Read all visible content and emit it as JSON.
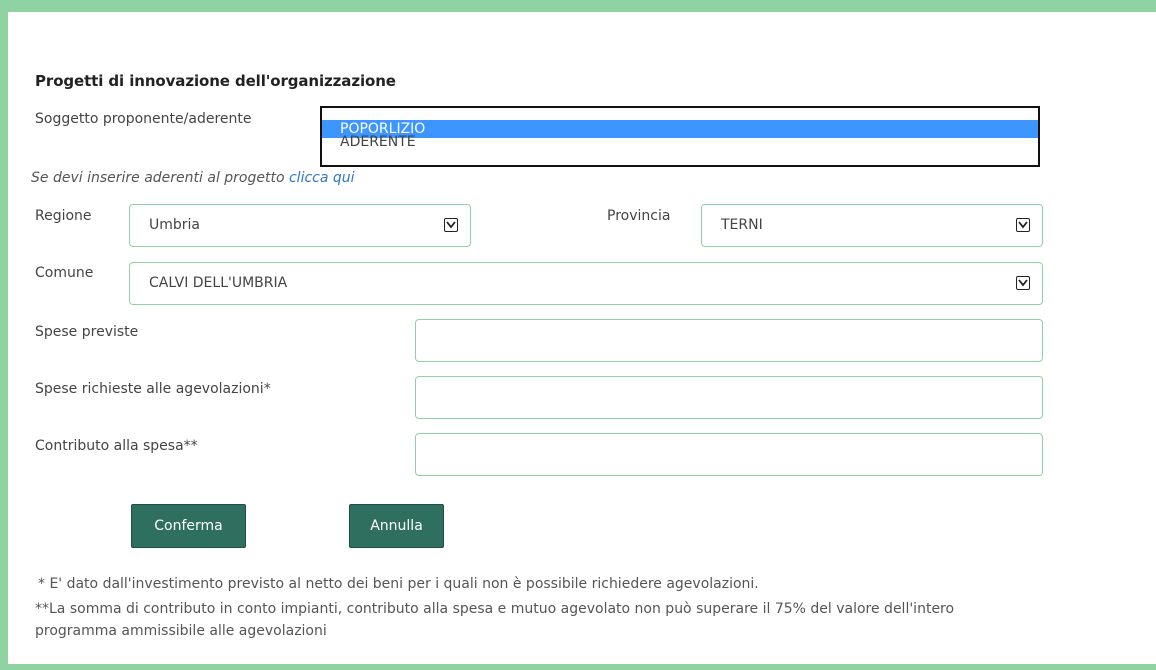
{
  "form": {
    "title": "Progetti di innovazione dell'organizzazione",
    "soggetto_label": "Soggetto proponente/aderente",
    "soggetto_options": [
      "POPORLIZIO",
      "ADERENTE"
    ],
    "hint_text": "Se devi inserire aderenti al progetto ",
    "hint_link": "clicca qui",
    "regione_label": "Regione",
    "regione_value": "Umbria",
    "provincia_label": "Provincia",
    "provincia_value": "TERNI",
    "comune_label": "Comune",
    "comune_value": "CALVI DELL'UMBRIA",
    "spese_previste_label": "Spese previste",
    "spese_previste_value": "",
    "spese_richieste_label": "Spese richieste alle agevolazioni*",
    "spese_richieste_value": "",
    "contributo_label": "Contributo alla spesa**",
    "contributo_value": ""
  },
  "buttons": {
    "confirm": "Conferma",
    "cancel": "Annulla"
  },
  "notes": {
    "note1": "* E' dato dall'investimento previsto al netto dei beni per i quali non è possibile richiedere agevolazioni.",
    "note2_line1": "**La somma di contributo in conto impianti, contributo alla spesa e mutuo agevolato non può superare il 75% del valore dell'intero",
    "note2_line2": "programma ammissibile alle agevolazioni"
  },
  "colors": {
    "frame_border": "#8fd3a3",
    "field_border": "#8fd3a3",
    "button_bg": "#2f6f60",
    "selected_option": "#3d95ff",
    "link": "#2e76c8"
  }
}
